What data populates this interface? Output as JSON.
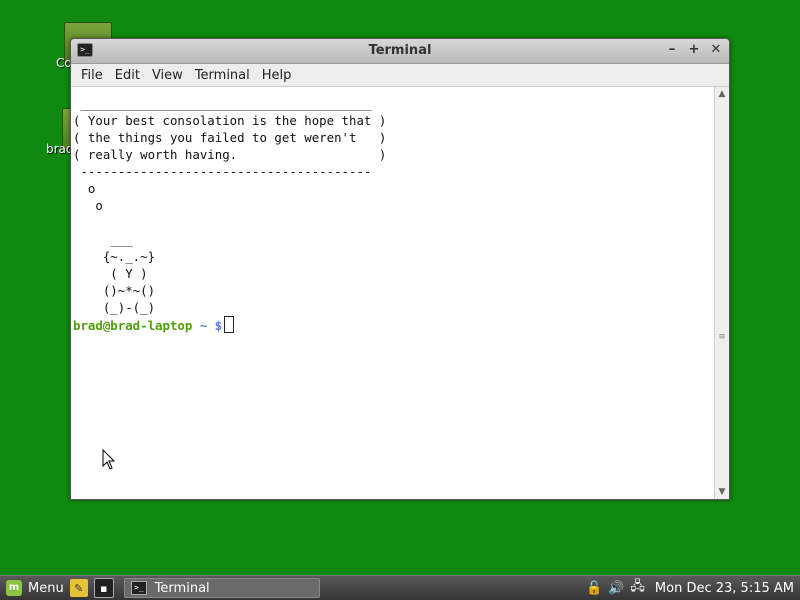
{
  "desktop": {
    "icons": [
      {
        "label": "Co"
      },
      {
        "label": "brad"
      }
    ]
  },
  "window": {
    "title": "Terminal",
    "menu": [
      "File",
      "Edit",
      "View",
      "Terminal",
      "Help"
    ]
  },
  "terminal": {
    "output": " _______________________________________\n( Your best consolation is the hope that )\n( the things you failed to get weren't   )\n( really worth having.                   )\n ---------------------------------------\n  o\n   o\n\n     ___\n    {~._.~}\n     ( Y )\n    ()~*~()\n    (_)-(_)",
    "prompt_user": "brad@brad-laptop",
    "prompt_dir": "~ $"
  },
  "taskbar": {
    "menu_label": "Menu",
    "task_label": "Terminal",
    "clock": "Mon Dec 23,  5:15 AM"
  }
}
